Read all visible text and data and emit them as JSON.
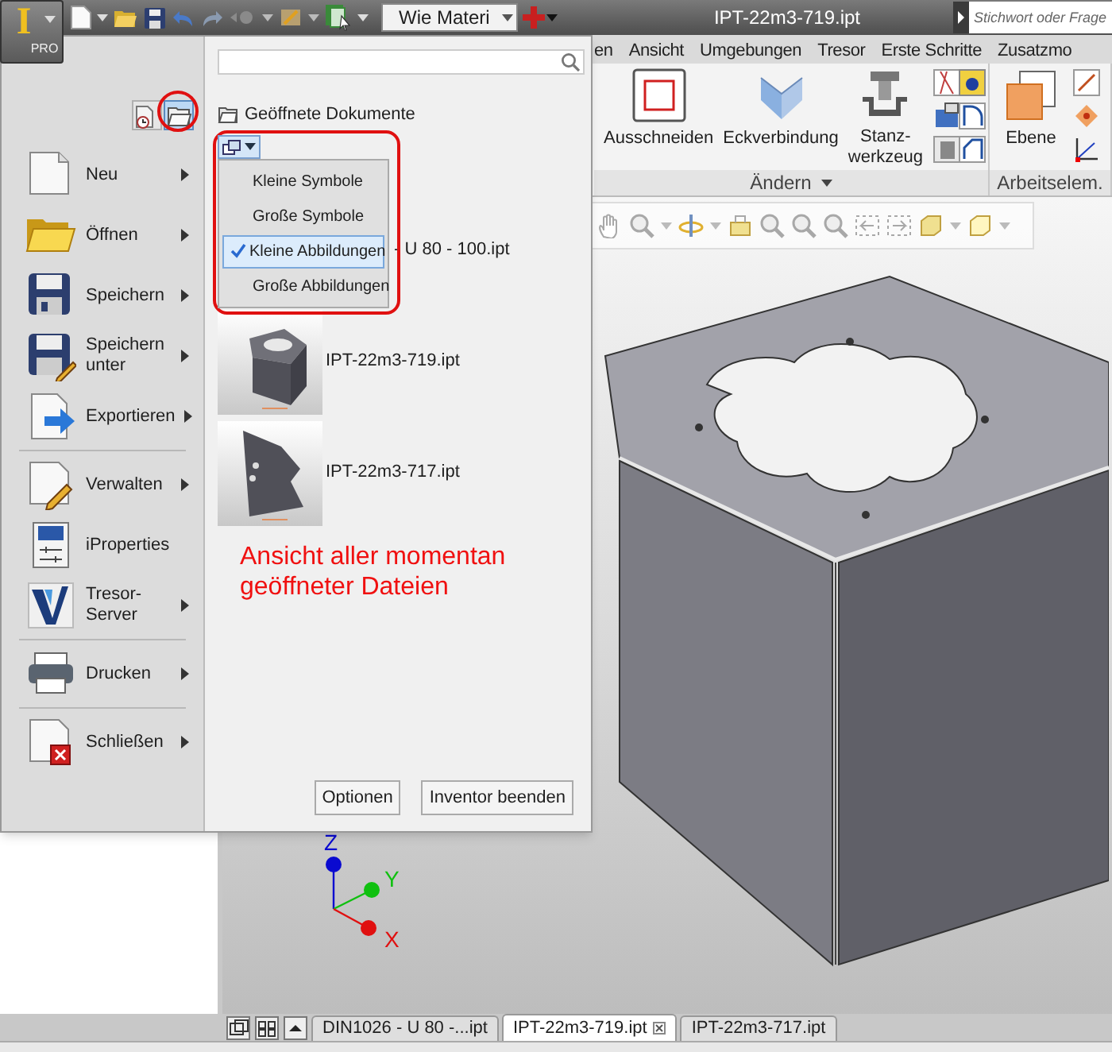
{
  "title_bar": {
    "app_button": {
      "letter": "I",
      "edition": "PRO"
    },
    "material": "Wie Materi",
    "title": "IPT-22m3-719.ipt",
    "search_placeholder": "Stichwort oder Frage"
  },
  "ribbon": {
    "tabs": [
      {
        "label": "en",
        "selected": false
      },
      {
        "label": "Ansicht",
        "selected": false
      },
      {
        "label": "Umgebungen",
        "selected": false
      },
      {
        "label": "Tresor",
        "selected": false
      },
      {
        "label": "Erste Schritte",
        "selected": false
      },
      {
        "label": "Zusatzmo",
        "selected": false
      }
    ],
    "panels": [
      {
        "title": "Ändern",
        "menu": true,
        "tools": [
          "Ausschneiden",
          "Eckverbindung",
          "Stanz-werkzeug"
        ]
      },
      {
        "title": "Arbeitselem.",
        "menu": false,
        "tools": [
          "Ebene"
        ]
      }
    ]
  },
  "app_menu": {
    "view_toggles": [
      {
        "selected": false
      },
      {
        "selected": true
      }
    ],
    "command_groups": [
      [
        {
          "label": "Neu",
          "submenu": true
        },
        {
          "label": "Öffnen",
          "submenu": true
        },
        {
          "label": "Speichern",
          "submenu": true
        },
        {
          "label": "Speichern unter",
          "submenu": true
        },
        {
          "label": "Exportieren",
          "submenu": true
        }
      ],
      [
        {
          "label": "Verwalten",
          "submenu": true
        },
        {
          "label": "iProperties",
          "submenu": false
        },
        {
          "label": "Tresor-Server",
          "submenu": true
        }
      ],
      [
        {
          "label": "Drucken",
          "submenu": true
        }
      ],
      [
        {
          "label": "Schließen",
          "submenu": true
        }
      ]
    ],
    "section_title": "Geöffnete Dokumente",
    "view_options": [
      {
        "label": "Kleine Symbole",
        "selected": false
      },
      {
        "label": "Große Symbole",
        "selected": false
      },
      {
        "label": "Kleine Abbildungen",
        "selected": true
      },
      {
        "label": "Große Abbildungen",
        "selected": false
      }
    ],
    "documents": [
      {
        "name": "- U 80 - 100.ipt",
        "thumbnail": false
      },
      {
        "name": "IPT-22m3-719.ipt",
        "thumbnail": true
      },
      {
        "name": "IPT-22m3-717.ipt",
        "thumbnail": true
      }
    ],
    "annotation": "Ansicht aller momentan geöffneter Dateien",
    "buttons": [
      "Optionen",
      "Inventor beenden"
    ]
  },
  "viewport": {
    "triad": [
      {
        "label": "Z",
        "color": "#0a0ad0"
      },
      {
        "label": "Y",
        "color": "#10c010"
      },
      {
        "label": "X",
        "color": "#e01010"
      }
    ]
  },
  "document_tabs": [
    {
      "label": "DIN1026 - U 80 -...ipt",
      "selected": false
    },
    {
      "label": "IPT-22m3-719.ipt",
      "selected": true
    },
    {
      "label": "IPT-22m3-717.ipt",
      "selected": false
    }
  ]
}
